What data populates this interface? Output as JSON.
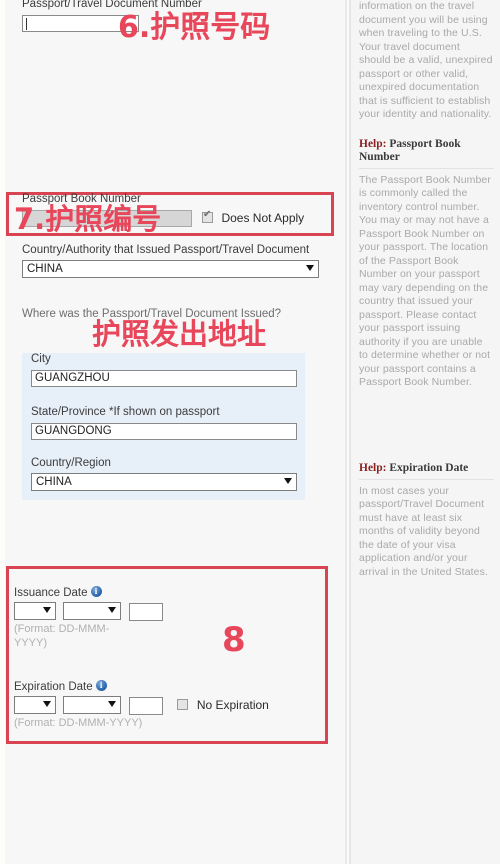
{
  "passport_number": {
    "label": "Passport/Travel Document Number",
    "value": "",
    "annotation": "6.护照号码"
  },
  "passport_book_number": {
    "label": "Passport Book Number",
    "value": "",
    "does_not_apply_label": "Does Not Apply",
    "does_not_apply_checked": true,
    "annotation": "7.护照编号"
  },
  "issuing_country": {
    "label": "Country/Authority that Issued Passport/Travel Document",
    "value": "CHINA"
  },
  "issued_where": {
    "label": "Where was the Passport/Travel Document Issued?",
    "annotation": "护照发出地址",
    "city": {
      "label": "City",
      "value": "GUANGZHOU"
    },
    "state": {
      "label": "State/Province *If shown on passport",
      "value": "GUANGDONG"
    },
    "country": {
      "label": "Country/Region",
      "value": "CHINA"
    }
  },
  "issuance_date": {
    "label": "Issuance Date",
    "day": "",
    "month": "",
    "year": "",
    "format_hint": "(Format: DD-MMM-YYYY)",
    "info_icon": "info-icon"
  },
  "expiration_date": {
    "label": "Expiration Date",
    "day": "",
    "month": "",
    "year": "",
    "format_hint": "(Format: DD-MMM-YYYY)",
    "no_expiration_label": "No Expiration",
    "no_expiration_checked": false,
    "info_icon": "info-icon"
  },
  "dates_annotation": "8",
  "help": {
    "intro_text": "information on the travel document you will be using when traveling to the U.S. Your travel document should be a valid, unexpired passport or other valid, unexpired documentation that is sufficient to establish your identity and nationality.",
    "book_number": {
      "title_prefix": "Help:",
      "title": "Passport Book Number",
      "body": "The Passport Book Number is commonly called the inventory control number. You may or may not have a Passport Book Number on your passport. The location of the Passport Book Number on your passport may vary depending on the country that issued your passport. Please contact your passport issuing authority if you are unable to determine whether or not your passport contains a Passport Book Number."
    },
    "expiration": {
      "title_prefix": "Help:",
      "title": "Expiration Date",
      "body": "In most cases your passport/Travel Document must have at least six months of validity beyond the date of your visa application and/or your arrival in the United States."
    }
  },
  "colors": {
    "annotation_red": "#e8465a",
    "box_red": "#d94452",
    "panel_blue": "#e7eff9",
    "help_title": "#8b2222"
  }
}
